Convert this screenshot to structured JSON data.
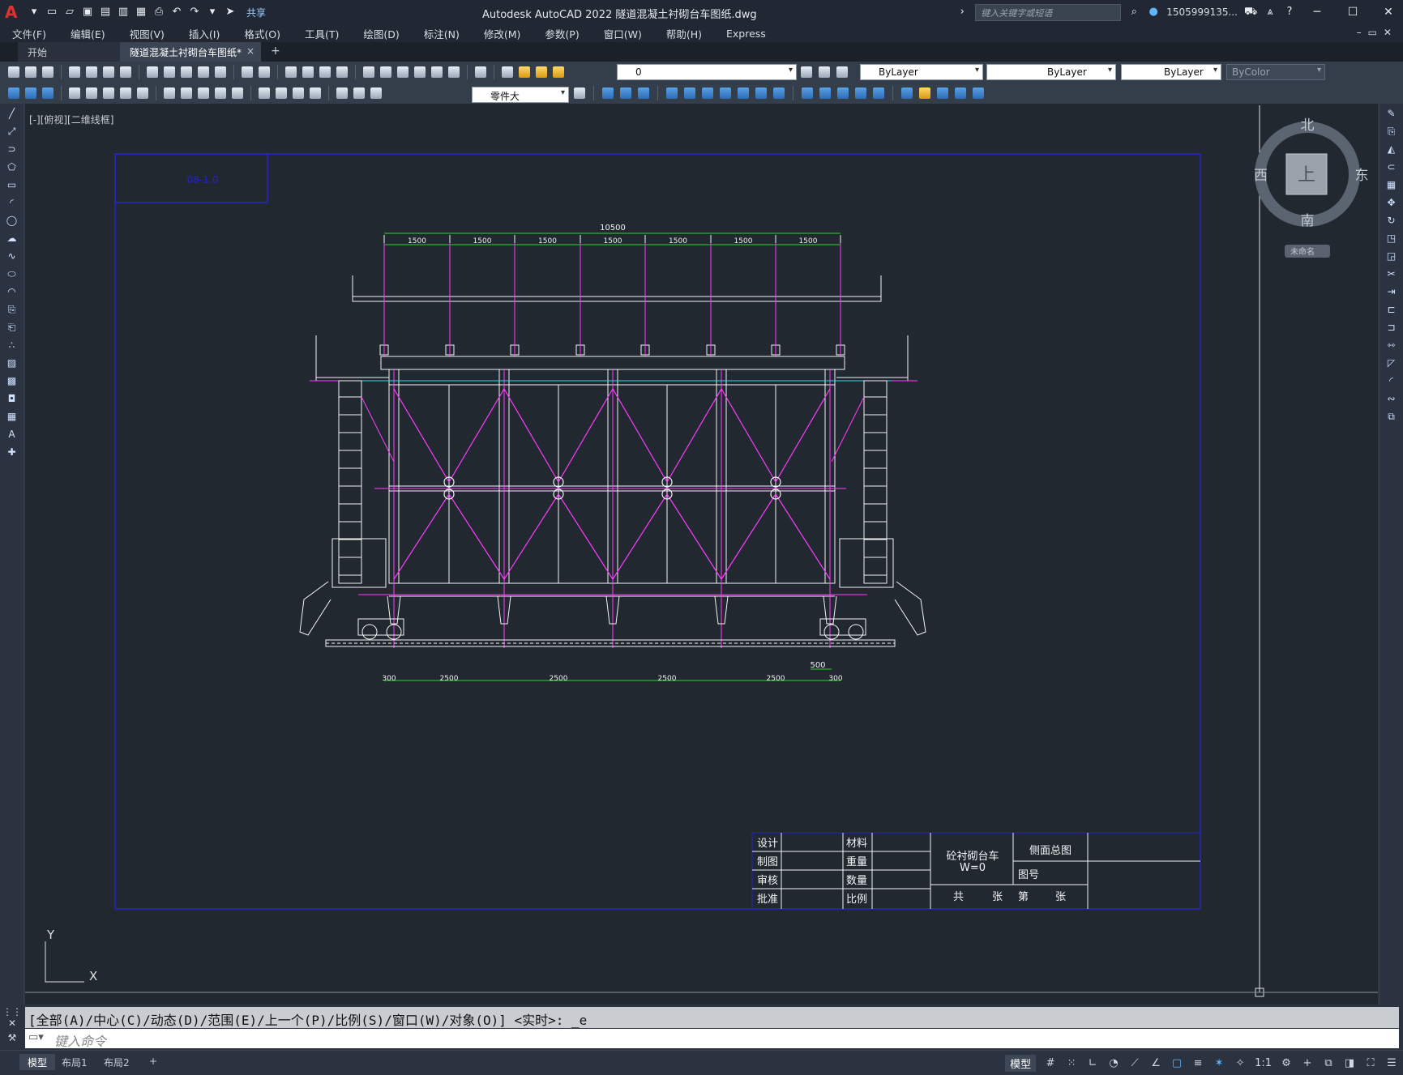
{
  "app": {
    "title": "Autodesk AutoCAD 2022    隧道混凝土衬砌台车图纸.dwg",
    "logo": "A",
    "share": "共享",
    "search_placeholder": "键入关键字或短语",
    "user": "1505999135...",
    "help": "?"
  },
  "menu": [
    "文件(F)",
    "编辑(E)",
    "视图(V)",
    "插入(I)",
    "格式(O)",
    "工具(T)",
    "绘图(D)",
    "标注(N)",
    "修改(M)",
    "参数(P)",
    "窗口(W)",
    "帮助(H)",
    "Express"
  ],
  "tabs": {
    "start": "开始",
    "active": "隧道混凝土衬砌台车图纸*",
    "close": "×",
    "add": "+"
  },
  "toolbar": {
    "layer": "0",
    "color": "ByLayer",
    "linetype": "ByLayer",
    "lineweight": "ByLayer",
    "plotstyle": "ByColor",
    "dimstyle": "零件大"
  },
  "viewport": {
    "label": "[-][俯视][二维线框]",
    "compass": {
      "north": "北",
      "south": "南",
      "east": "东",
      "west": "西",
      "top": "上",
      "wcs": "未命名"
    }
  },
  "drawing": {
    "ref_box": "08-1.0",
    "dims_top_total": "10500",
    "dims_top": [
      "1500",
      "1500",
      "1500",
      "1500",
      "1500",
      "1500",
      "1500"
    ],
    "dims_bottom": [
      "300",
      "2500",
      "2500",
      "2500",
      "2500",
      "300"
    ],
    "dim_500": "500",
    "title_block": {
      "design": "设计",
      "draft": "制图",
      "review": "审核",
      "approve": "批准",
      "material": "材料",
      "weight": "重量",
      "quantity": "数量",
      "scale": "比例",
      "name": "砼衬砌台车",
      "wval": "W=0",
      "sheet_title": "侧面总图",
      "drawing_no": "图号",
      "total": "共",
      "sheets1": "张",
      "number": "第",
      "sheets2": "张"
    },
    "ucs": {
      "y": "Y",
      "x": "X"
    }
  },
  "command": {
    "history": "[全部(A)/中心(C)/动态(D)/范围(E)/上一个(P)/比例(S)/窗口(W)/对象(O)] <实时>: _e",
    "placeholder": "键入命令"
  },
  "status": {
    "layouts": [
      "模型",
      "布局1",
      "布局2"
    ],
    "add": "+",
    "model": "模型",
    "scale": "1:1"
  },
  "colors": {
    "magenta": "#ff3cff",
    "green": "#2bd42b",
    "cyan": "#2ed7e8",
    "blue": "#2424c8",
    "white": "#f4f4f4"
  }
}
